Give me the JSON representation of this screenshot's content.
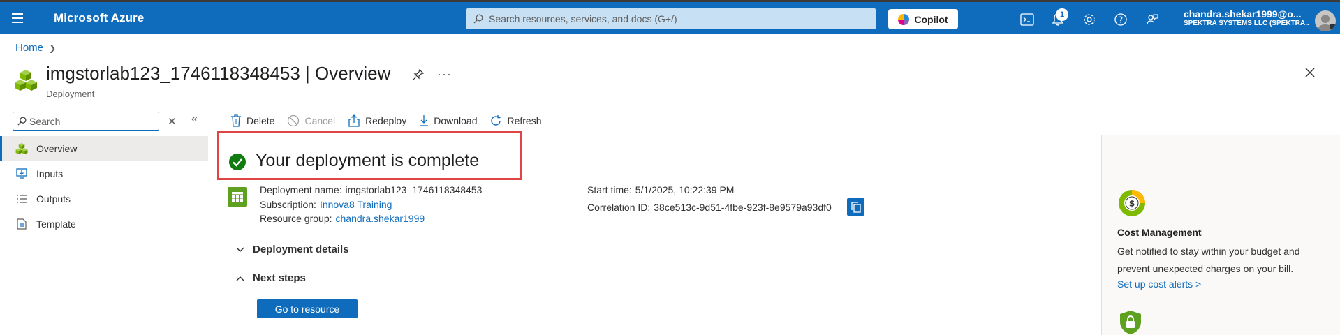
{
  "topbar": {
    "brand": "Microsoft Azure",
    "search_placeholder": "Search resources, services, and docs (G+/)",
    "copilot_label": "Copilot",
    "notification_count": "1",
    "account_name": "chandra.shekar1999@o...",
    "account_org": "SPEKTRA SYSTEMS LLC (SPEKTRA..."
  },
  "breadcrumb": {
    "home": "Home"
  },
  "header": {
    "title": "imgstorlab123_1746118348453 | Overview",
    "subtitle": "Deployment"
  },
  "nav": {
    "search_placeholder": "Search",
    "items": [
      {
        "label": "Overview",
        "icon": "overview-icon"
      },
      {
        "label": "Inputs",
        "icon": "inputs-icon"
      },
      {
        "label": "Outputs",
        "icon": "outputs-icon"
      },
      {
        "label": "Template",
        "icon": "template-icon"
      }
    ]
  },
  "toolbar": {
    "delete": "Delete",
    "cancel": "Cancel",
    "redeploy": "Redeploy",
    "download": "Download",
    "refresh": "Refresh"
  },
  "main": {
    "status_text": "Your deployment is complete",
    "deployment_name_label": "Deployment name:",
    "deployment_name_value": "imgstorlab123_1746118348453",
    "subscription_label": "Subscription:",
    "subscription_value": "Innova8 Training",
    "resource_group_label": "Resource group:",
    "resource_group_value": "chandra.shekar1999",
    "start_time_label": "Start time:",
    "start_time_value": "5/1/2025, 10:22:39 PM",
    "correlation_label": "Correlation ID:",
    "correlation_value": "38ce513c-9d51-4fbe-923f-8e9579a93df0",
    "deployment_details": "Deployment details",
    "next_steps": "Next steps",
    "goto_resource": "Go to resource"
  },
  "right_panel": {
    "cost_title": "Cost Management",
    "cost_desc": "Get notified to stay within your budget and prevent unexpected charges on your bill.",
    "cost_link": "Set up cost alerts >"
  },
  "colors": {
    "azure_blue": "#0f6cbd",
    "success_green": "#107c10",
    "highlight_red": "#e04545"
  }
}
